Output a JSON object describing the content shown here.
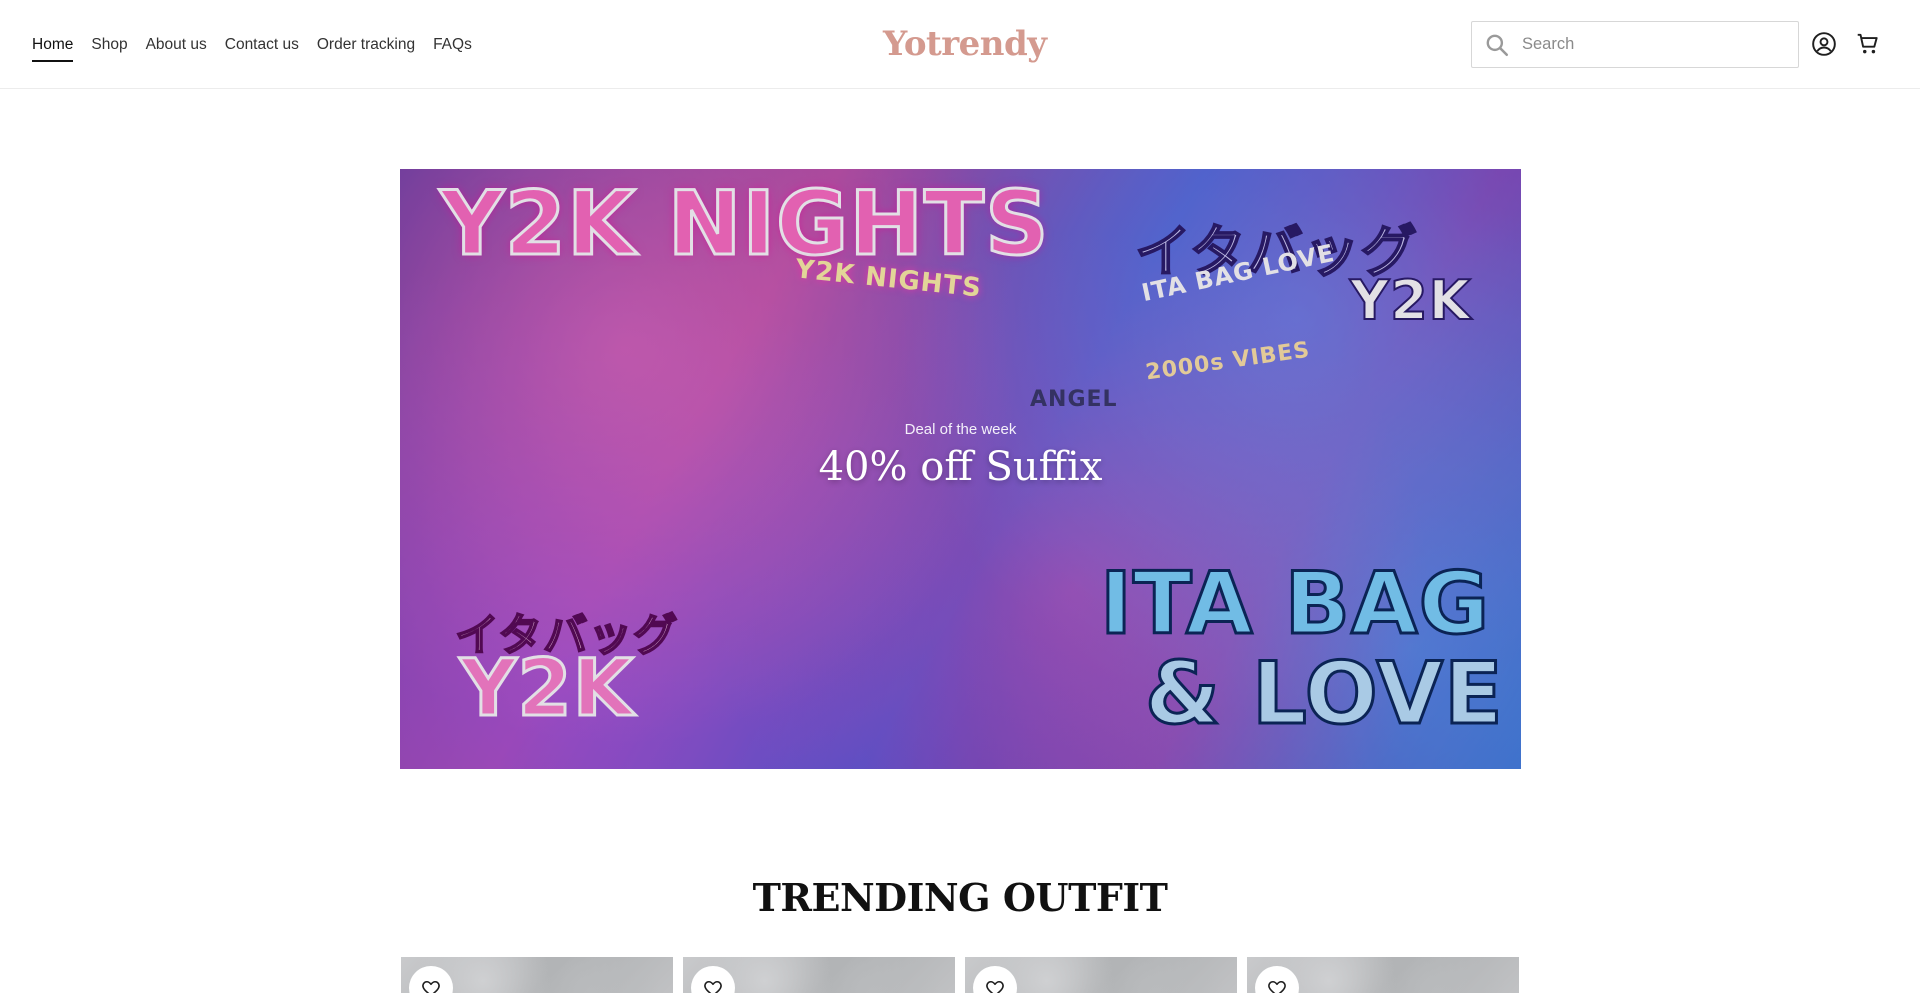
{
  "nav": {
    "items": [
      {
        "label": "Home"
      },
      {
        "label": "Shop"
      },
      {
        "label": "About us"
      },
      {
        "label": "Contact us"
      },
      {
        "label": "Order tracking"
      },
      {
        "label": "FAQs"
      }
    ],
    "active": "Home"
  },
  "brand": {
    "logo": "Yotrendy",
    "logo_color": "#d49a8f"
  },
  "search": {
    "placeholder": "Search"
  },
  "icons": {
    "search": "search-icon",
    "account": "account-icon",
    "cart": "cart-icon",
    "wishlist": "heart-icon"
  },
  "hero": {
    "eyebrow": "Deal of the week",
    "headline": "40% off Suffix",
    "art_text": {
      "y2k_nights": "Y2K NIGHTS",
      "jp_top": "イタバッグ",
      "y2k_top": "Y2K",
      "ita_bag": "ITA BAG",
      "love": "& LOVE",
      "jp_bottom": "イタバッグ",
      "y2k_bottom": "Y2K",
      "neon_sign": "Y2K NIGHTS",
      "ita_bag_love_sign": "ITA BAG LOVE",
      "vibes_sign": "2000s VIBES",
      "shirt": "ANGEL"
    }
  },
  "trending": {
    "title": "TRENDING OUTFIT"
  }
}
